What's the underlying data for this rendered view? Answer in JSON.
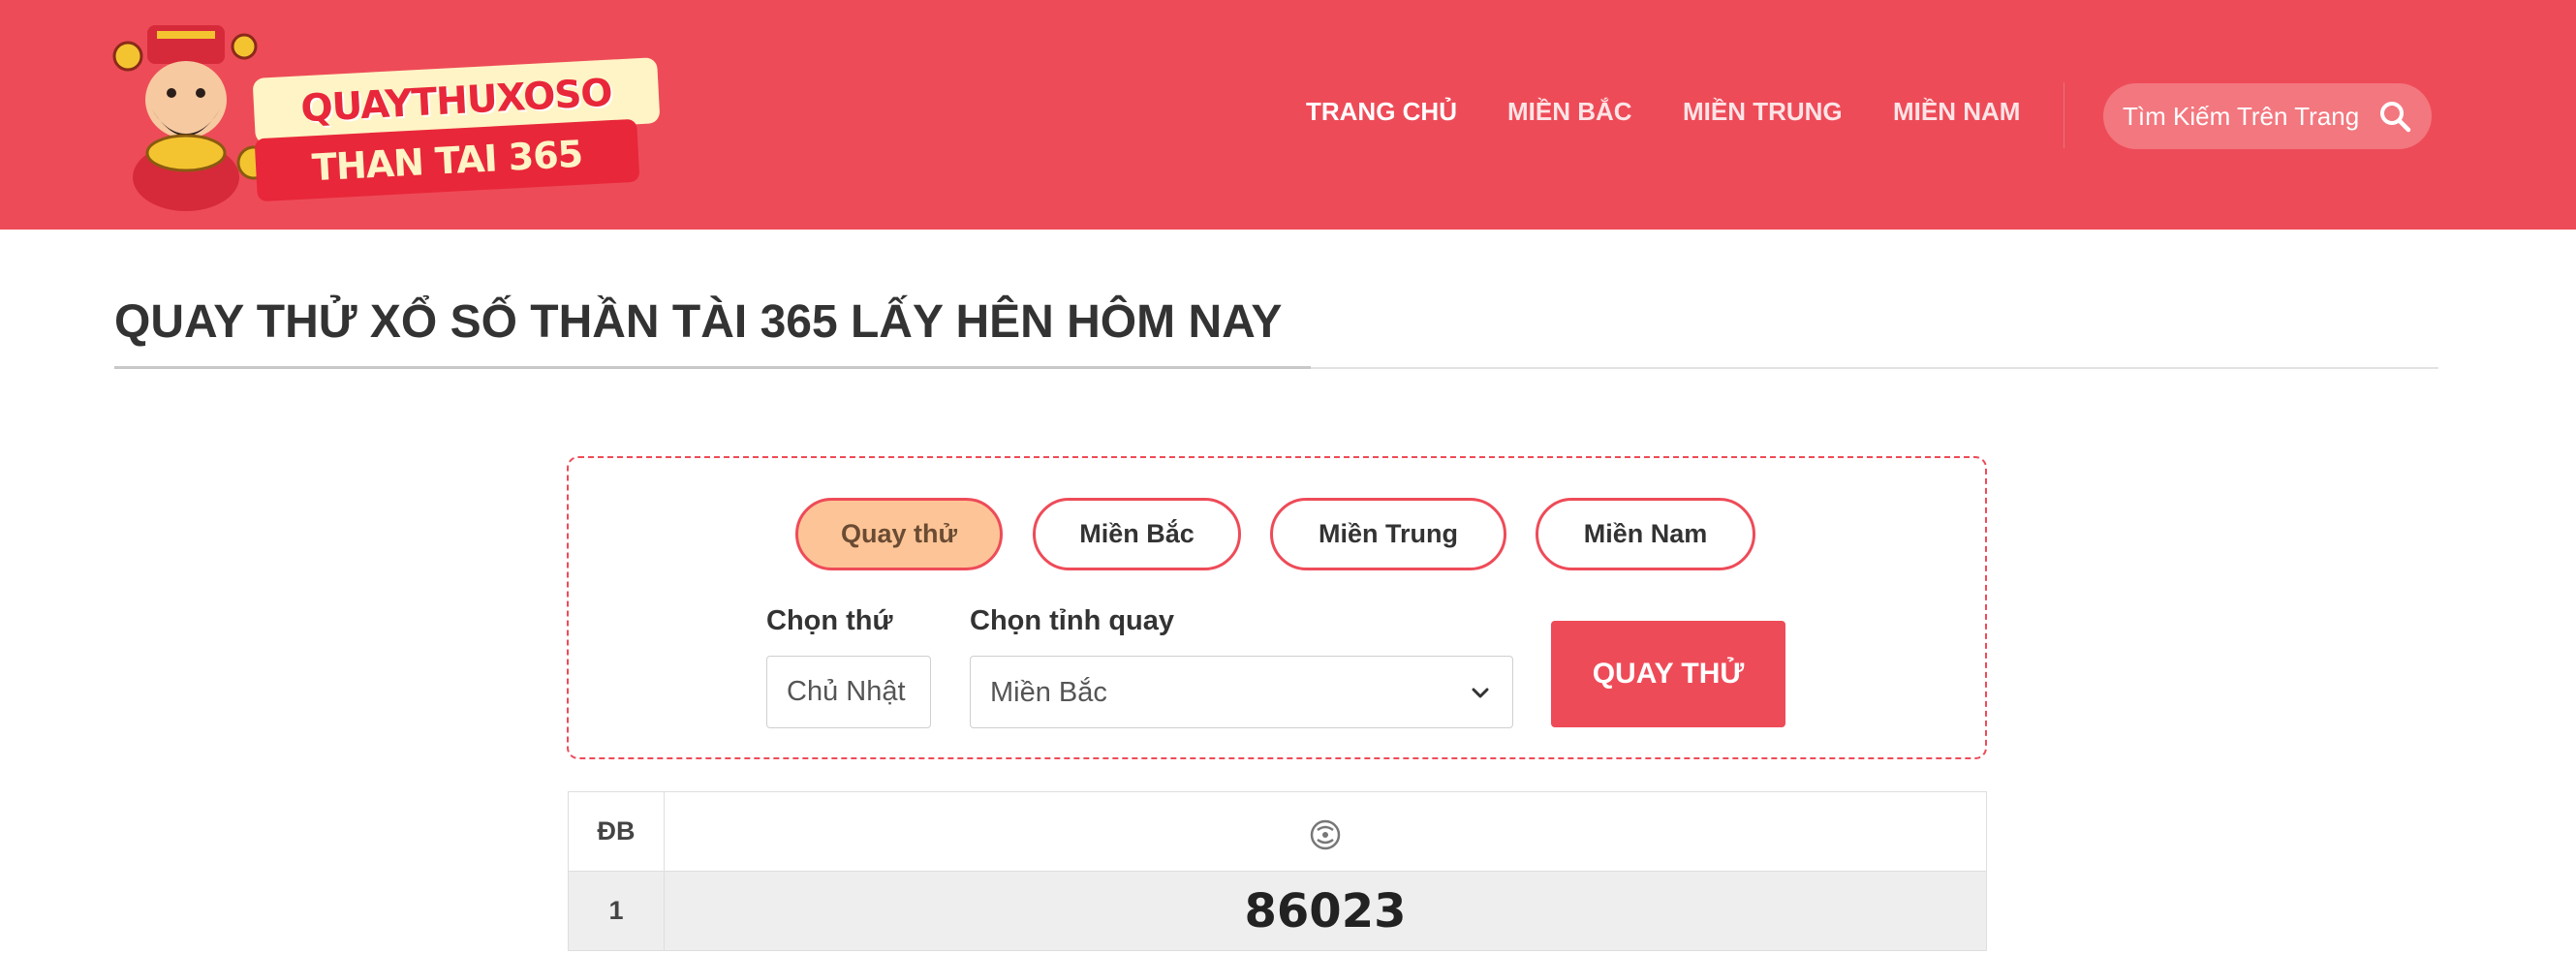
{
  "header": {
    "logo": {
      "line1": "QUAYTHUXOSO",
      "line2": "THAN TAI 365"
    },
    "nav": [
      {
        "label": "TRANG CHỦ"
      },
      {
        "label": "MIỀN BẮC"
      },
      {
        "label": "MIỀN TRUNG"
      },
      {
        "label": "MIỀN NAM"
      }
    ],
    "search": {
      "placeholder": "Tìm Kiếm Trên Trang",
      "icon": "search-icon"
    }
  },
  "page": {
    "title": "QUAY THỬ XỔ SỐ THẦN TÀI 365 LẤY HÊN HÔM NAY"
  },
  "form": {
    "tabs": [
      {
        "label": "Quay thử",
        "active": true
      },
      {
        "label": "Miền Bắc",
        "active": false
      },
      {
        "label": "Miền Trung",
        "active": false
      },
      {
        "label": "Miền Nam",
        "active": false
      }
    ],
    "day_label": "Chọn thứ",
    "day_value": "Chủ Nhật",
    "province_label": "Chọn tỉnh quay",
    "province_value": "Miền Bắc",
    "submit_label": "QUAY THỬ"
  },
  "results": {
    "rows": [
      {
        "prize": "ĐB",
        "value": "",
        "icon": "spinner-icon"
      },
      {
        "prize": "1",
        "value": "86023"
      }
    ]
  },
  "colors": {
    "brand": "#ee4b58",
    "active_tab": "#fdc597"
  }
}
